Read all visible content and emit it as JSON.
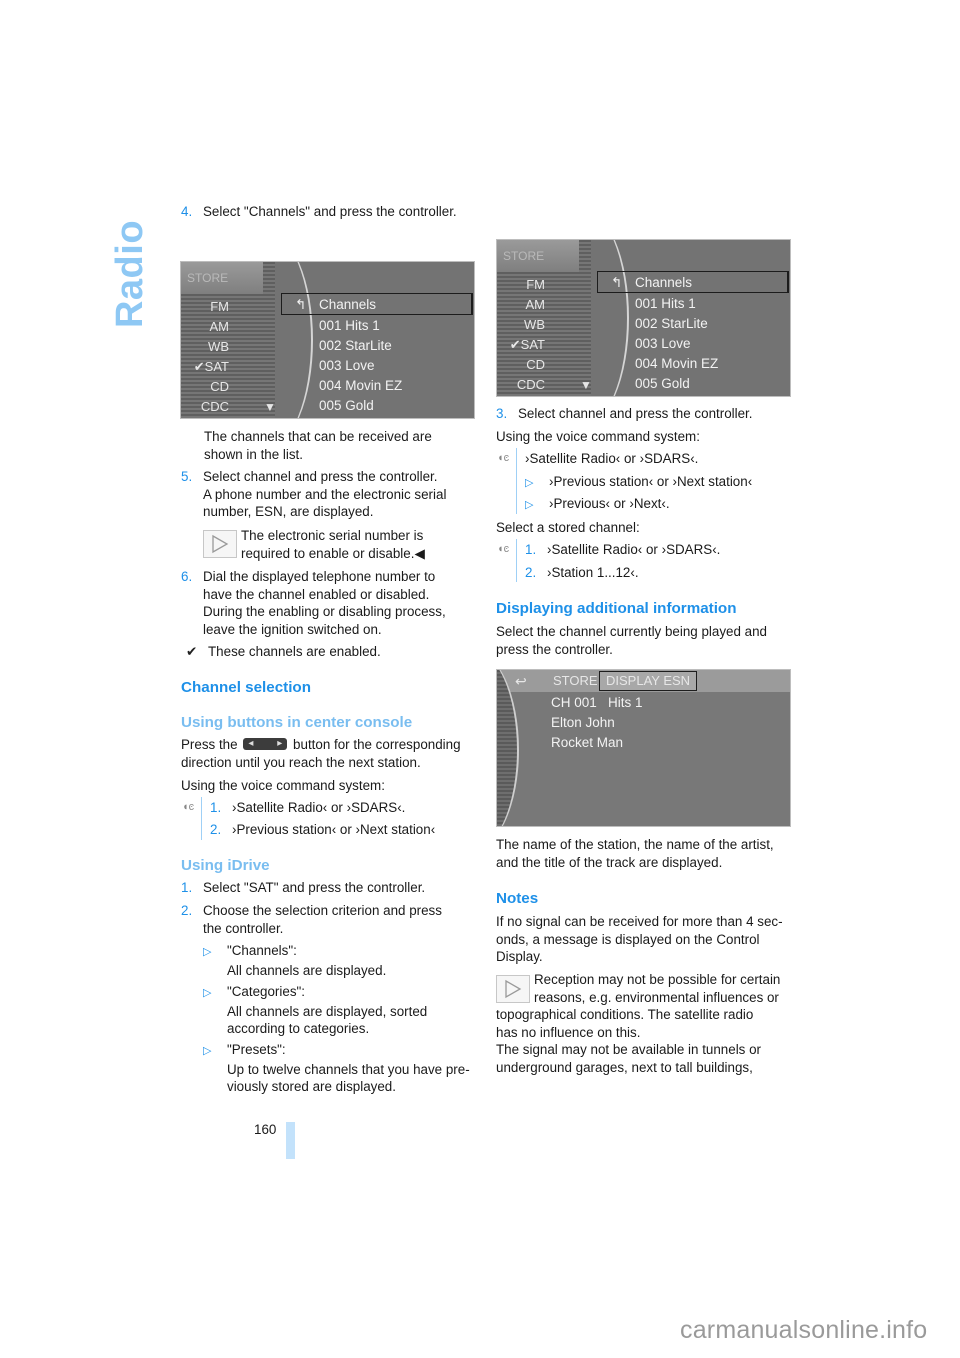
{
  "section_tab": "Radio",
  "left_column": {
    "step4": {
      "num": "4.",
      "text": "Select \"Channels\" and press the controller."
    },
    "screen1": {
      "store_label": "STORE",
      "bands": [
        "FM",
        "AM",
        "WB",
        "SAT",
        "CD",
        "CDC"
      ],
      "checked_band": "SAT",
      "header": "Channels",
      "channels": [
        "001 Hits 1",
        "002 StarLite",
        "003 Love",
        "004 Movin EZ",
        "005 Gold"
      ]
    },
    "after_screen_lines": [
      "The channels that can be received are",
      "shown in the list."
    ],
    "step5": {
      "num": "5.",
      "lines": [
        "Select channel and press the controller.",
        "A phone number and the electronic serial",
        "number, ESN, are displayed."
      ]
    },
    "note1_lines": [
      "The electronic serial number is",
      "required to enable or disable.◀"
    ],
    "step6": {
      "num": "6.",
      "lines": [
        "Dial the displayed telephone number to",
        "have the channel enabled or disabled.",
        "During the enabling or disabling process,",
        "leave the ignition switched on."
      ]
    },
    "check_note": "These channels are enabled.",
    "h_channel_selection": "Channel selection",
    "h_buttons": "Using buttons in center console",
    "buttons_para": {
      "before": "Press the",
      "after": "button for the corresponding",
      "line2": "direction until you reach the next station."
    },
    "voice_intro": "Using the voice command system:",
    "voice_steps": [
      {
        "num": "1.",
        "text": "›Satellite Radio‹ or ›SDARS‹."
      },
      {
        "num": "2.",
        "text": "›Previous station‹ or ›Next station‹"
      }
    ],
    "h_idrive": "Using iDrive",
    "idrive_step1": {
      "num": "1.",
      "text": "Select \"SAT\" and press the controller."
    },
    "idrive_step2": {
      "num": "2.",
      "lines": [
        "Choose the selection criterion and press",
        "the controller."
      ]
    },
    "criteria": [
      {
        "title": "\"Channels\":",
        "lines": [
          "All channels are displayed."
        ]
      },
      {
        "title": "\"Categories\":",
        "lines": [
          "All channels are displayed, sorted",
          "according to categories."
        ]
      },
      {
        "title": "\"Presets\":",
        "lines": [
          "Up to twelve channels that you have pre-",
          "viously stored are displayed."
        ]
      }
    ]
  },
  "right_column": {
    "screen2": {
      "store_label": "STORE",
      "bands": [
        "FM",
        "AM",
        "WB",
        "SAT",
        "CD",
        "CDC"
      ],
      "checked_band": "SAT",
      "header": "Channels",
      "channels": [
        "001 Hits 1",
        "002 StarLite",
        "003 Love",
        "004 Movin EZ",
        "005 Gold"
      ]
    },
    "step3": {
      "num": "3.",
      "text": "Select channel and press the controller."
    },
    "voice_intro": "Using the voice command system:",
    "voice_first": "›Satellite Radio‹ or ›SDARS‹.",
    "voice_bullets": [
      "›Previous station‹ or ›Next station‹",
      "›Previous‹ or ›Next‹."
    ],
    "stored_intro": "Select a stored channel:",
    "stored_steps": [
      {
        "num": "1.",
        "text": "›Satellite Radio‹ or ›SDARS‹."
      },
      {
        "num": "2.",
        "text": "›Station 1...12‹."
      }
    ],
    "h_additional": "Displaying additional information",
    "additional_lines": [
      "Select the channel currently being played and",
      "press the controller."
    ],
    "screen3": {
      "store_label": "STORE",
      "esn_label": "DISPLAY ESN",
      "info": [
        "CH 001   Hits 1",
        "Elton John",
        "Rocket Man"
      ]
    },
    "after_screen3": [
      "The name of the station, the name of the artist,",
      "and the title of the track are displayed."
    ],
    "h_notes": "Notes",
    "notes_para": [
      "If no signal can be received for more than 4 sec-",
      "onds, a message is displayed on the Control",
      "Display."
    ],
    "note2_first": [
      "Reception may not be possible for certain",
      "reasons, e.g. environmental influences or"
    ],
    "note2_rest": [
      "topographical conditions. The satellite radio",
      "has no influence on this.",
      "The signal may not be available in tunnels or",
      "underground garages, next to tall buildings,"
    ]
  },
  "footer": {
    "page_number": "160",
    "watermark": "carmanualsonline.info"
  },
  "colors": {
    "accent": "#1e90e8",
    "subheading": "#79bdf0",
    "section_tab": "#8ec8f4",
    "page_bar": "#c3e2fb"
  }
}
